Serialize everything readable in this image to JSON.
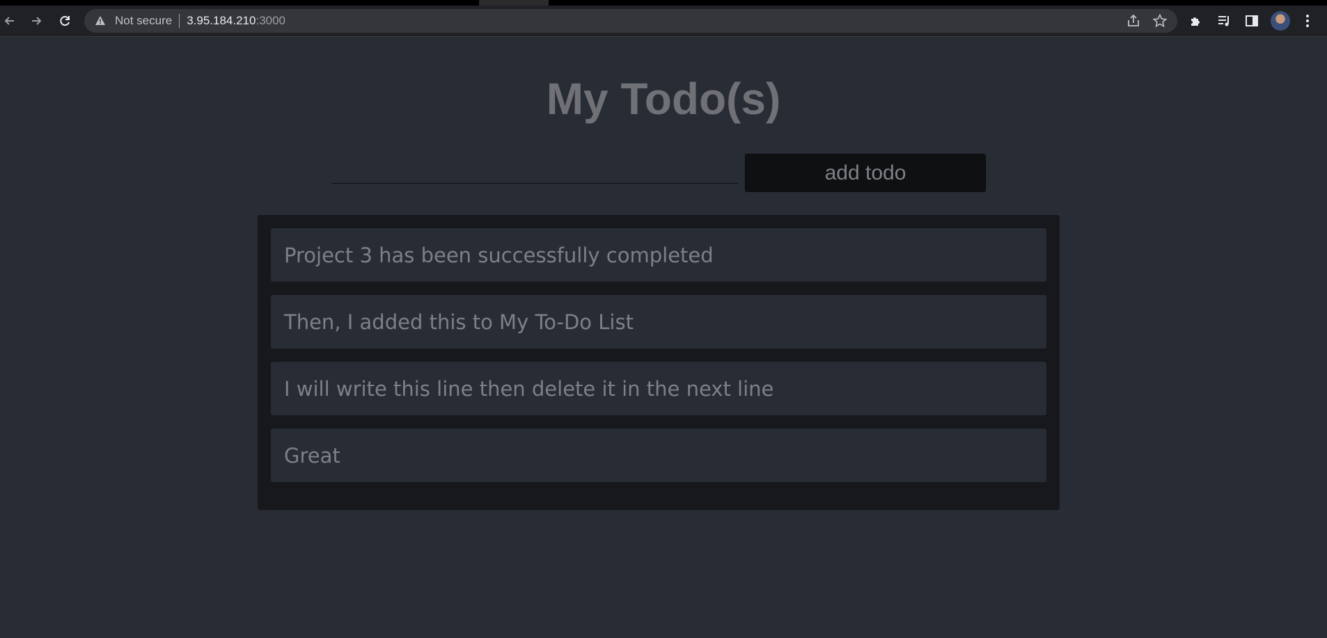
{
  "browser": {
    "security_label": "Not secure",
    "url_host": "3.95.184.210",
    "url_port": ":3000",
    "icons": [
      "back-arrow-icon",
      "forward-arrow-icon",
      "reload-icon",
      "warning-icon",
      "share-icon",
      "star-icon",
      "extensions-icon",
      "media-queue-icon",
      "side-panel-icon",
      "avatar",
      "menu-dots-icon"
    ]
  },
  "app": {
    "title": "My Todo(s)",
    "input": {
      "value": "",
      "placeholder": ""
    },
    "add_button_label": "add todo",
    "todos": [
      "Project 3 has been successfully completed",
      "Then, I added this to My To-Do List",
      "I will write this line then delete it in the next line",
      "Great"
    ]
  },
  "colors": {
    "page_bg": "#282c35",
    "panel_bg": "#16181c",
    "item_bg": "#282c35",
    "text_muted": "#7d8087",
    "title": "#707177",
    "button_bg": "#0f1012"
  }
}
